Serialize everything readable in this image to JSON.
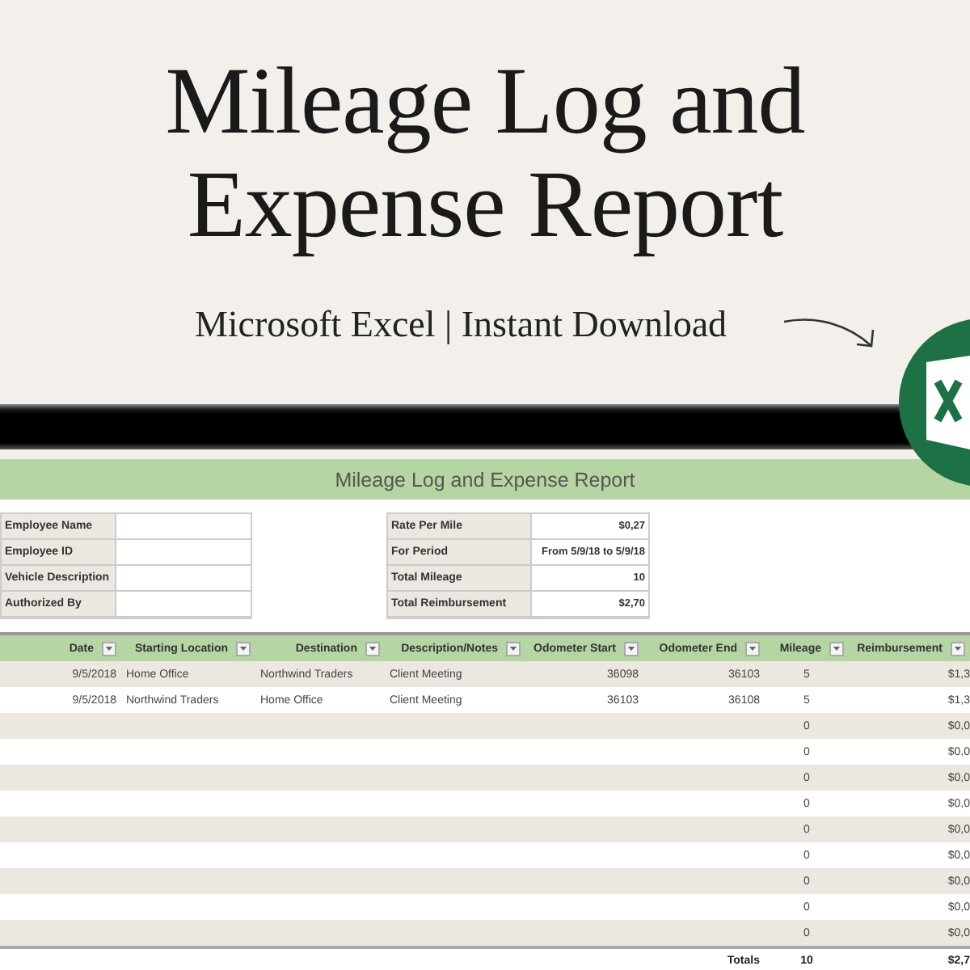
{
  "header": {
    "title_lines": [
      "Mileage Log and",
      "Expense Report"
    ],
    "subtitle": "Microsoft Excel | Instant Download"
  },
  "sheet": {
    "title": "Mileage Log and Expense Report",
    "employee_info": [
      "Employee Name",
      "Employee ID",
      "Vehicle Description",
      "Authorized By"
    ],
    "summary": [
      {
        "label": "Rate Per Mile",
        "value": "$0,27"
      },
      {
        "label": "For Period",
        "value": "From 5/9/18 to 5/9/18"
      },
      {
        "label": "Total Mileage",
        "value": "10"
      },
      {
        "label": "Total Reimbursement",
        "value": "$2,70"
      }
    ],
    "table": {
      "columns": [
        "Date",
        "Starting Location",
        "Destination",
        "Description/Notes",
        "Odometer Start",
        "Odometer End",
        "Mileage",
        "Reimbursement"
      ],
      "rows": [
        {
          "date": "9/5/2018",
          "starting_location": "Home Office",
          "destination": "Northwind Traders",
          "description": "Client Meeting",
          "odometer_start": "36098",
          "odometer_end": "36103",
          "mileage": "5",
          "reimbursement": "$1,3"
        },
        {
          "date": "9/5/2018",
          "starting_location": "Northwind Traders",
          "destination": "Home Office",
          "description": "Client Meeting",
          "odometer_start": "36103",
          "odometer_end": "36108",
          "mileage": "5",
          "reimbursement": "$1,3"
        },
        {
          "mileage": "0",
          "reimbursement": "$0,0"
        },
        {
          "mileage": "0",
          "reimbursement": "$0,0"
        },
        {
          "mileage": "0",
          "reimbursement": "$0,0"
        },
        {
          "mileage": "0",
          "reimbursement": "$0,0"
        },
        {
          "mileage": "0",
          "reimbursement": "$0,0"
        },
        {
          "mileage": "0",
          "reimbursement": "$0,0"
        },
        {
          "mileage": "0",
          "reimbursement": "$0,0"
        },
        {
          "mileage": "0",
          "reimbursement": "$0,0"
        },
        {
          "mileage": "0",
          "reimbursement": "$0,0"
        }
      ],
      "totals": {
        "label": "Totals",
        "mileage": "10",
        "reimbursement": "$2,7"
      }
    }
  }
}
